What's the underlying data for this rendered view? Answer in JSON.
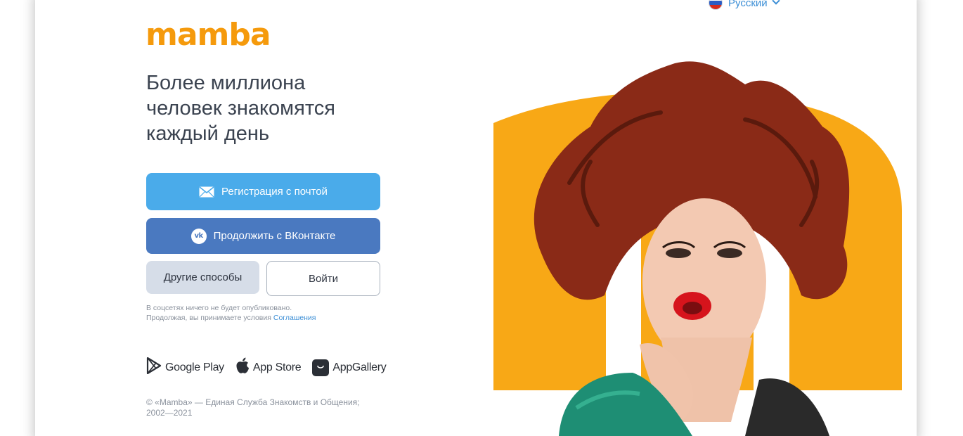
{
  "language": {
    "label": "Русский"
  },
  "brand": {
    "logo_text": "mamba",
    "accent_color": "#f59a0c"
  },
  "headline": [
    "Более миллиона",
    "человек знакомятся",
    "каждый день"
  ],
  "buttons": {
    "email_register": "Регистрация с почтой",
    "vk_continue": "Продолжить с ВКонтакте",
    "other_methods": "Другие способы",
    "login": "Войти"
  },
  "legal": {
    "line1": "В соцсетях ничего не будет опубликовано.",
    "line2_prefix": "Продолжая, вы принимаете условия ",
    "agreement_link": "Соглашения"
  },
  "stores": [
    {
      "label": "Google Play",
      "icon": "google-play-icon"
    },
    {
      "label": "App Store",
      "icon": "apple-icon"
    },
    {
      "label": "AppGallery",
      "icon": "huawei-appgallery-icon"
    }
  ],
  "copyright": {
    "line1": "© «Mamba» — Единая Служба Знакомств и Общения;",
    "line2": "2002—2021"
  },
  "colors": {
    "email_button": "#4aabea",
    "vk_button": "#4a79c0",
    "other_button": "#d6dde8",
    "link": "#3d8fd6"
  }
}
